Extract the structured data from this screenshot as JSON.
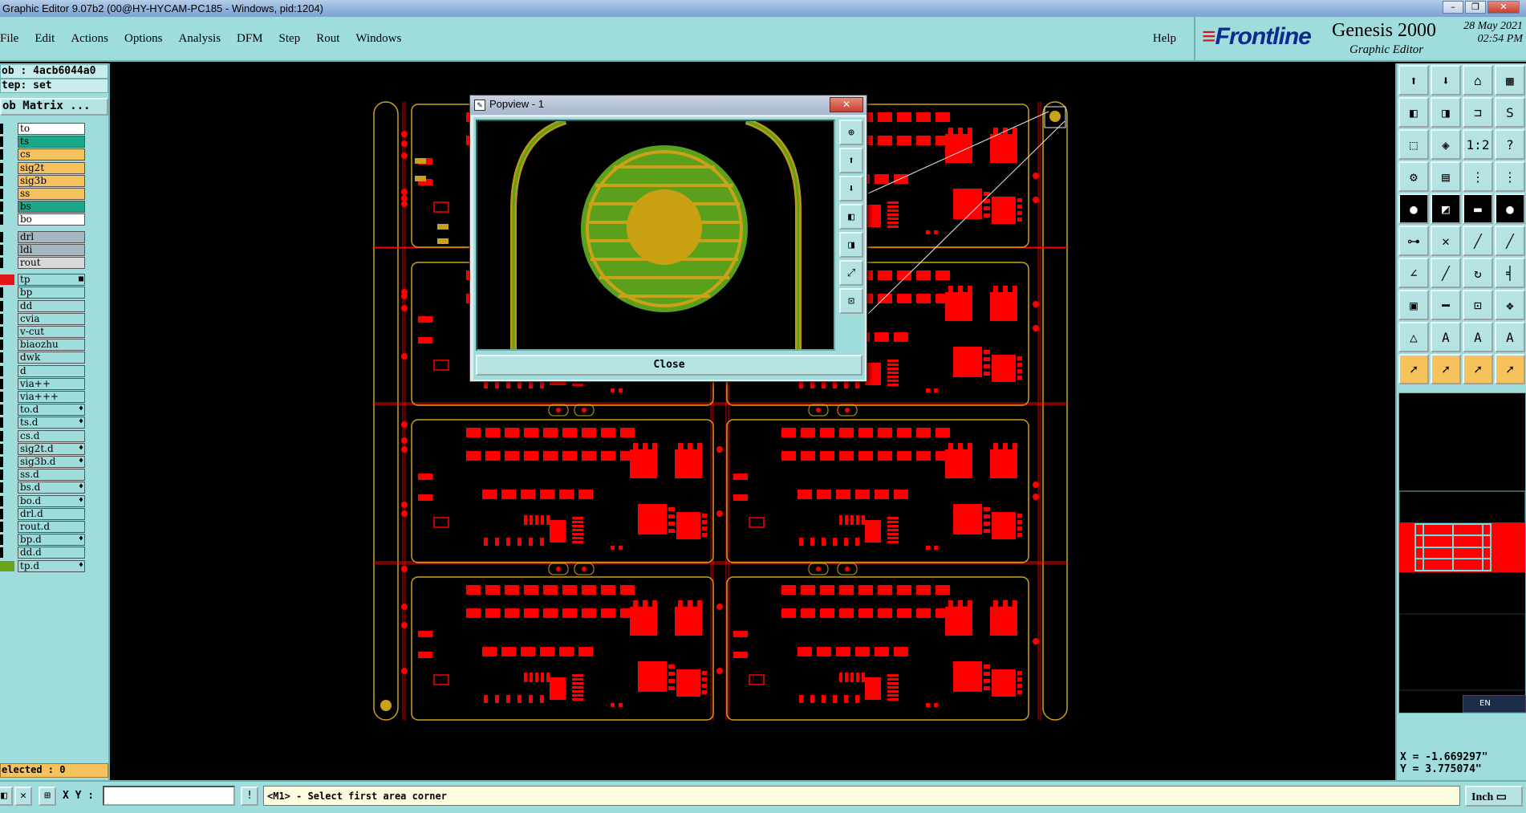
{
  "window": {
    "title": "Graphic Editor 9.07b2 (00@HY-HYCAM-PC185 - Windows, pid:1204)",
    "controls": [
      "–",
      "❐",
      "✕"
    ]
  },
  "menu": [
    "File",
    "Edit",
    "Actions",
    "Options",
    "Analysis",
    "DFM",
    "Step",
    "Rout",
    "Windows"
  ],
  "help": "Help",
  "logo": {
    "brand": "Frontline",
    "product": "Genesis 2000",
    "subtitle": "Graphic Editor",
    "date": "28 May 2021",
    "time": "02:54 PM"
  },
  "job": {
    "job_text": "ob : 4acb6044a0",
    "step_text": "tep: set",
    "matrix_label": "ob Matrix ..."
  },
  "layers": [
    {
      "name": "to",
      "bg": "#ffffff",
      "fl": ""
    },
    {
      "name": "ts",
      "bg": "#1aa889",
      "fl": ""
    },
    {
      "name": "cs",
      "bg": "#f5c25e",
      "fl": ""
    },
    {
      "name": "sig2t",
      "bg": "#f5c25e",
      "fl": ""
    },
    {
      "name": "sig3b",
      "bg": "#f5c25e",
      "fl": ""
    },
    {
      "name": "ss",
      "bg": "#f5c25e",
      "fl": ""
    },
    {
      "name": "bs",
      "bg": "#1aa889",
      "fl": ""
    },
    {
      "name": "bo",
      "bg": "#ffffff",
      "fl": ""
    },
    {
      "name": "drl",
      "bg": "#a3b8c2",
      "fl": ""
    },
    {
      "name": "ldi",
      "bg": "#a3b8c2",
      "fl": ""
    },
    {
      "name": "rout",
      "bg": "#d9d9d9",
      "fl": ""
    },
    {
      "name": "tp",
      "bg": "#9fdcdc",
      "fl": "■",
      "mark": "#e0151c"
    },
    {
      "name": "bp",
      "bg": "#9fdcdc",
      "fl": ""
    },
    {
      "name": "dd",
      "bg": "#9fdcdc",
      "fl": ""
    },
    {
      "name": "cvia",
      "bg": "#9fdcdc",
      "fl": ""
    },
    {
      "name": "v-cut",
      "bg": "#9fdcdc",
      "fl": ""
    },
    {
      "name": "biaozhu",
      "bg": "#9fdcdc",
      "fl": ""
    },
    {
      "name": "dwk",
      "bg": "#9fdcdc",
      "fl": ""
    },
    {
      "name": "d",
      "bg": "#9fdcdc",
      "fl": ""
    },
    {
      "name": "via++",
      "bg": "#9fdcdc",
      "fl": ""
    },
    {
      "name": "via+++",
      "bg": "#9fdcdc",
      "fl": ""
    },
    {
      "name": "to.d",
      "bg": "#9fdcdc",
      "fl": "♦"
    },
    {
      "name": "ts.d",
      "bg": "#9fdcdc",
      "fl": "♦"
    },
    {
      "name": "cs.d",
      "bg": "#9fdcdc",
      "fl": ""
    },
    {
      "name": "sig2t.d",
      "bg": "#9fdcdc",
      "fl": "♦"
    },
    {
      "name": "sig3b.d",
      "bg": "#9fdcdc",
      "fl": "♦"
    },
    {
      "name": "ss.d",
      "bg": "#9fdcdc",
      "fl": ""
    },
    {
      "name": "bs.d",
      "bg": "#9fdcdc",
      "fl": "♦"
    },
    {
      "name": "bo.d",
      "bg": "#9fdcdc",
      "fl": "♦"
    },
    {
      "name": "drl.d",
      "bg": "#9fdcdc",
      "fl": ""
    },
    {
      "name": "rout.d",
      "bg": "#9fdcdc",
      "fl": ""
    },
    {
      "name": "bp.d",
      "bg": "#9fdcdc",
      "fl": "♦"
    },
    {
      "name": "dd.d",
      "bg": "#9fdcdc",
      "fl": ""
    },
    {
      "name": "tp.d",
      "bg": "#9fdcdc",
      "fl": "♦",
      "mark": "#6aa31a"
    }
  ],
  "selected": "elected : 0",
  "tools": [
    {
      "icon": "open-icon",
      "glyph": "⬆",
      "style": ""
    },
    {
      "icon": "save-icon",
      "glyph": "⬇",
      "style": ""
    },
    {
      "icon": "home-icon",
      "glyph": "⌂",
      "style": ""
    },
    {
      "icon": "window-icon",
      "glyph": "▦",
      "style": ""
    },
    {
      "icon": "layer-in-icon",
      "glyph": "◧",
      "style": ""
    },
    {
      "icon": "layer-out-icon",
      "glyph": "◨",
      "style": ""
    },
    {
      "icon": "route-icon",
      "glyph": "⊐",
      "style": ""
    },
    {
      "icon": "snake-icon",
      "glyph": "S",
      "style": ""
    },
    {
      "icon": "zoom-fit-icon",
      "glyph": "⬚",
      "style": ""
    },
    {
      "icon": "zoom-page-icon",
      "glyph": "◈",
      "style": ""
    },
    {
      "icon": "one-to-one-icon",
      "glyph": "1:2",
      "style": ""
    },
    {
      "icon": "help-icon",
      "glyph": "?",
      "style": ""
    },
    {
      "icon": "measure-icon",
      "glyph": "⚙",
      "style": ""
    },
    {
      "icon": "grid-icon",
      "glyph": "▤",
      "style": ""
    },
    {
      "icon": "tree-icon",
      "glyph": "⋮",
      "style": ""
    },
    {
      "icon": "tree-alt-icon",
      "glyph": "⋮",
      "style": ""
    },
    {
      "icon": "pad-icon",
      "glyph": "●",
      "style": "dk"
    },
    {
      "icon": "line-icon",
      "glyph": "◩",
      "style": "dk"
    },
    {
      "icon": "ruler-icon",
      "glyph": "▬",
      "style": "dk"
    },
    {
      "icon": "circle-icon",
      "glyph": "●",
      "style": "dk"
    },
    {
      "icon": "connect-icon",
      "glyph": "⊶",
      "style": ""
    },
    {
      "icon": "cross-icon",
      "glyph": "✕",
      "style": ""
    },
    {
      "icon": "segment-icon",
      "glyph": "╱",
      "style": ""
    },
    {
      "icon": "segment-alt-icon",
      "glyph": "╱",
      "style": ""
    },
    {
      "icon": "angle-icon",
      "glyph": "∠",
      "style": ""
    },
    {
      "icon": "slash-icon",
      "glyph": "╱",
      "style": ""
    },
    {
      "icon": "arc-icon",
      "glyph": "↻",
      "style": ""
    },
    {
      "icon": "comb-icon",
      "glyph": "╡",
      "style": ""
    },
    {
      "icon": "pad-edit-icon",
      "glyph": "▣",
      "style": ""
    },
    {
      "icon": "dash-icon",
      "glyph": "━",
      "style": ""
    },
    {
      "icon": "bracket-icon",
      "glyph": "⊡",
      "style": ""
    },
    {
      "icon": "group-icon",
      "glyph": "❖",
      "style": ""
    },
    {
      "icon": "triangle-icon",
      "glyph": "△",
      "style": ""
    },
    {
      "icon": "a-shape-icon",
      "glyph": "A",
      "style": ""
    },
    {
      "icon": "a-shape-alt-icon",
      "glyph": "A",
      "style": ""
    },
    {
      "icon": "a-shape-alt2-icon",
      "glyph": "A",
      "style": ""
    },
    {
      "icon": "select-icon",
      "glyph": "➚",
      "style": "or"
    },
    {
      "icon": "select-alt-icon",
      "glyph": "➚",
      "style": "or"
    },
    {
      "icon": "select-arc-icon",
      "glyph": "➚",
      "style": "or"
    },
    {
      "icon": "select-net-icon",
      "glyph": "➚",
      "style": "or"
    }
  ],
  "coords": {
    "x": "X = -1.669297\"",
    "y": "Y = 3.775074\""
  },
  "ime": "EN",
  "status": {
    "xy_label": "X Y :",
    "xy_value": "",
    "prompt": "<M1> - Select first area corner",
    "unit": "Inch"
  },
  "popview": {
    "title": "Popview - 1",
    "close_label": "Close",
    "close_x": "✕",
    "tools": [
      "zoom-in-icon",
      "zoom-out-icon",
      "zoom-home-icon",
      "pan-icon",
      "page-icon",
      "fit-icon",
      "center-icon"
    ]
  }
}
